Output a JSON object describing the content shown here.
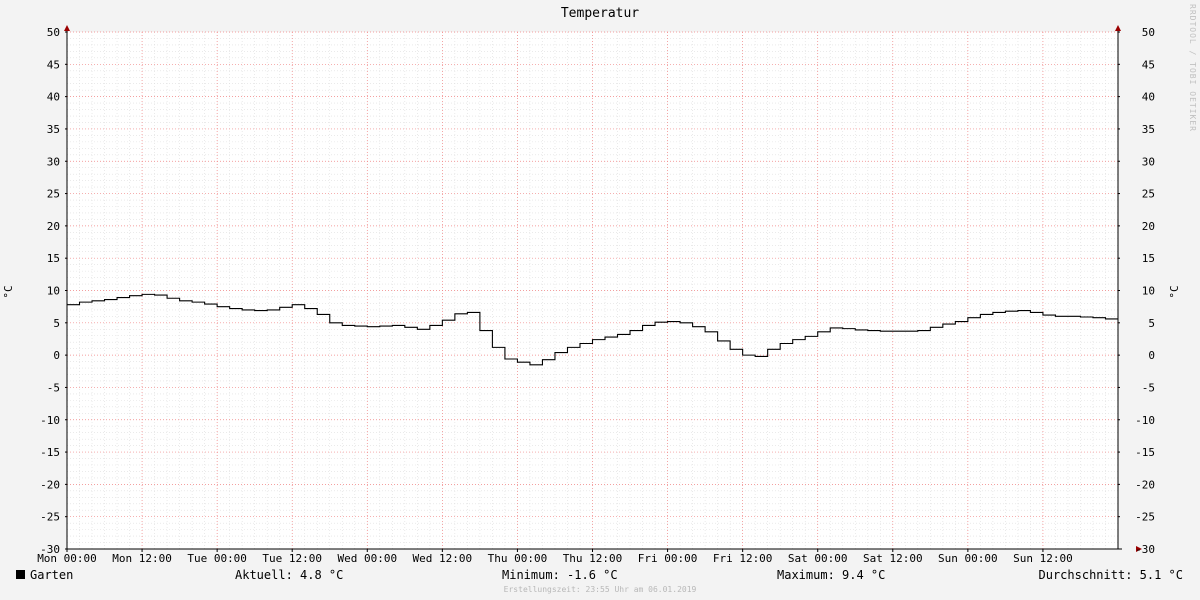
{
  "chart_data": {
    "type": "line",
    "title": "Temperatur",
    "ylabel": "°C",
    "ylim": [
      -30,
      50
    ],
    "y_ticks": [
      50,
      45,
      40,
      35,
      30,
      25,
      20,
      15,
      10,
      5,
      0,
      -5,
      -10,
      -15,
      -20,
      -25,
      -30
    ],
    "x_ticks": [
      "Mon 00:00",
      "Mon 12:00",
      "Tue 00:00",
      "Tue 12:00",
      "Wed 00:00",
      "Wed 12:00",
      "Thu 00:00",
      "Thu 12:00",
      "Fri 00:00",
      "Fri 12:00",
      "Sat 00:00",
      "Sat 12:00",
      "Sun 00:00",
      "Sun 12:00"
    ],
    "x_range_hours": [
      0,
      168
    ],
    "grid": true,
    "series": [
      {
        "name": "Garten",
        "color": "#000000",
        "x": [
          0,
          2,
          4,
          6,
          8,
          10,
          12,
          14,
          16,
          18,
          20,
          22,
          24,
          26,
          28,
          30,
          32,
          34,
          36,
          38,
          40,
          42,
          44,
          46,
          48,
          50,
          52,
          54,
          56,
          58,
          60,
          62,
          64,
          66,
          68,
          70,
          72,
          74,
          76,
          78,
          80,
          82,
          84,
          86,
          88,
          90,
          92,
          94,
          96,
          98,
          100,
          102,
          104,
          106,
          108,
          110,
          112,
          114,
          116,
          118,
          120,
          122,
          124,
          126,
          128,
          130,
          132,
          134,
          136,
          138,
          140,
          142,
          144,
          146,
          148,
          150,
          152,
          154,
          156,
          158,
          160,
          162,
          164,
          166
        ],
        "values": [
          7.8,
          8.2,
          8.4,
          8.6,
          8.9,
          9.2,
          9.4,
          9.3,
          8.8,
          8.4,
          8.2,
          7.9,
          7.5,
          7.2,
          7.0,
          6.9,
          7.0,
          7.4,
          7.8,
          7.2,
          6.3,
          5.0,
          4.6,
          4.5,
          4.4,
          4.5,
          4.6,
          4.3,
          4.0,
          4.6,
          5.4,
          6.4,
          6.6,
          3.8,
          1.2,
          -0.6,
          -1.1,
          -1.5,
          -0.7,
          0.4,
          1.2,
          1.8,
          2.4,
          2.8,
          3.2,
          3.8,
          4.6,
          5.1,
          5.2,
          5.0,
          4.4,
          3.6,
          2.2,
          0.9,
          0.0,
          -0.2,
          0.9,
          1.8,
          2.4,
          2.9,
          3.6,
          4.2,
          4.1,
          3.9,
          3.8,
          3.7,
          3.7,
          3.7,
          3.8,
          4.3,
          4.8,
          5.2,
          5.8,
          6.3,
          6.6,
          6.8,
          6.9,
          6.6,
          6.2,
          6.0,
          6.0,
          5.9,
          5.8,
          5.6
        ]
      }
    ],
    "legend": {
      "series_name": "Garten",
      "aktuell": "Aktuell: 4.8 °C",
      "minimum": "Minimum: -1.6 °C",
      "maximum": "Maximum: 9.4 °C",
      "durchschnitt": "Durchschnitt: 5.1 °C"
    },
    "footer": "Erstellungszeit: 23:55 Uhr am 06.01.2019",
    "watermark": "RRDTOOL / TOBI OETIKER"
  }
}
